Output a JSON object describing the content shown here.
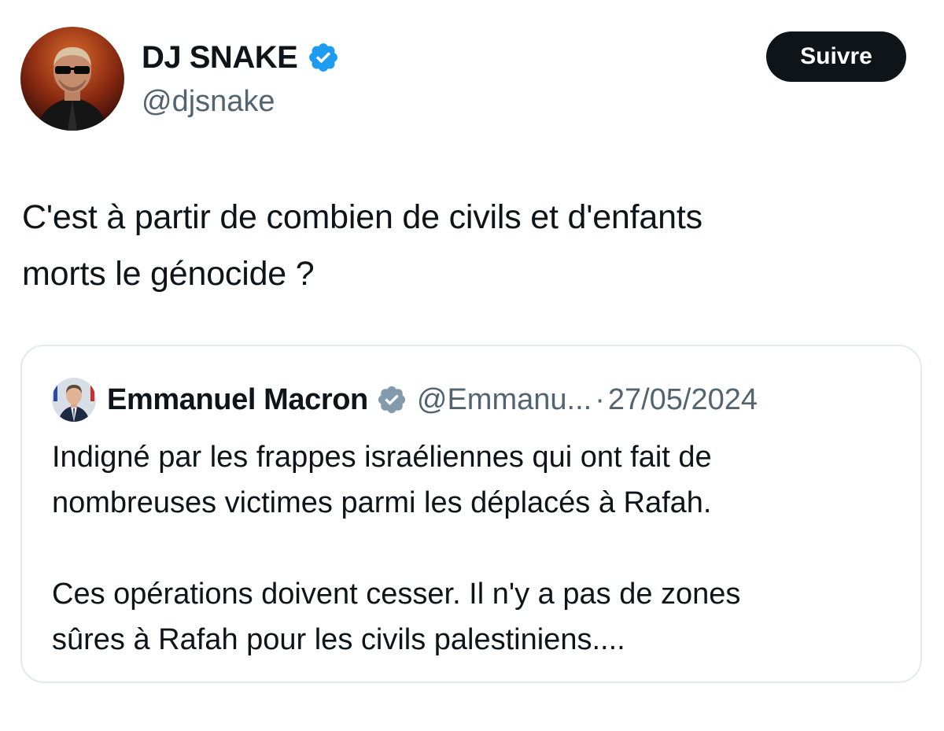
{
  "author": {
    "display_name": "DJ SNAKE",
    "handle": "@djsnake",
    "verified": true,
    "avatar_icon": "profile-photo-djsnake"
  },
  "follow_button": {
    "label": "Suivre"
  },
  "tweet": {
    "text": "C'est à partir de combien de civils et d'enfants\nmorts le génocide ?"
  },
  "quoted_tweet": {
    "display_name": "Emmanuel Macron",
    "handle": "@Emmanu...",
    "separator": "·",
    "date": "27/05/2024",
    "verified": true,
    "avatar_icon": "profile-photo-macron",
    "text": "Indigné par les frappes israéliennes qui ont fait de\nnombreuses victimes parmi les déplacés à Rafah.\n\nCes opérations doivent cesser. Il n'y a pas de zones\nsûres à Rafah pour les civils palestiniens...."
  },
  "colors": {
    "verified_blue": "#1d9bf0",
    "verified_gray": "#829aab",
    "text_primary": "#0f1419",
    "text_secondary": "#536471",
    "button_bg": "#0f1419",
    "card_border": "#e6e9ec"
  }
}
